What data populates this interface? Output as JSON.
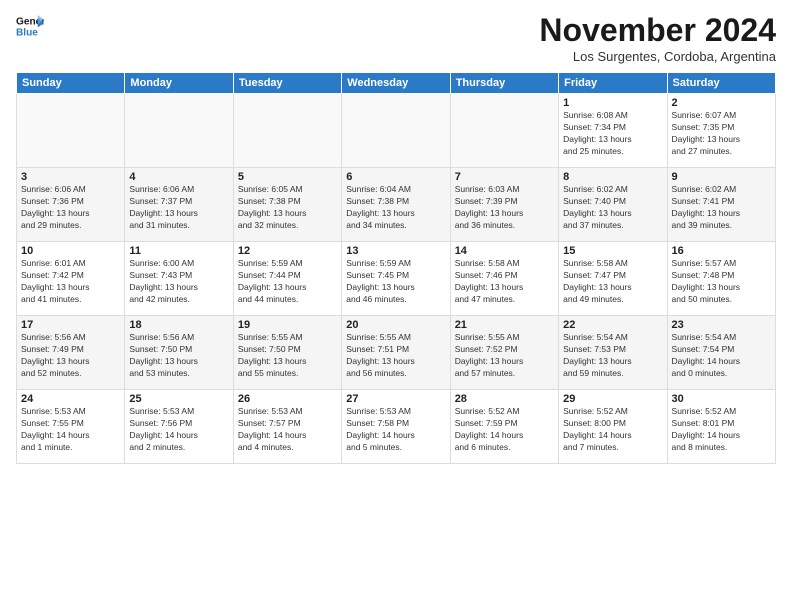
{
  "header": {
    "logo_line1": "General",
    "logo_line2": "Blue",
    "month_title": "November 2024",
    "location": "Los Surgentes, Cordoba, Argentina"
  },
  "weekdays": [
    "Sunday",
    "Monday",
    "Tuesday",
    "Wednesday",
    "Thursday",
    "Friday",
    "Saturday"
  ],
  "weeks": [
    [
      {
        "day": "",
        "info": ""
      },
      {
        "day": "",
        "info": ""
      },
      {
        "day": "",
        "info": ""
      },
      {
        "day": "",
        "info": ""
      },
      {
        "day": "",
        "info": ""
      },
      {
        "day": "1",
        "info": "Sunrise: 6:08 AM\nSunset: 7:34 PM\nDaylight: 13 hours\nand 25 minutes."
      },
      {
        "day": "2",
        "info": "Sunrise: 6:07 AM\nSunset: 7:35 PM\nDaylight: 13 hours\nand 27 minutes."
      }
    ],
    [
      {
        "day": "3",
        "info": "Sunrise: 6:06 AM\nSunset: 7:36 PM\nDaylight: 13 hours\nand 29 minutes."
      },
      {
        "day": "4",
        "info": "Sunrise: 6:06 AM\nSunset: 7:37 PM\nDaylight: 13 hours\nand 31 minutes."
      },
      {
        "day": "5",
        "info": "Sunrise: 6:05 AM\nSunset: 7:38 PM\nDaylight: 13 hours\nand 32 minutes."
      },
      {
        "day": "6",
        "info": "Sunrise: 6:04 AM\nSunset: 7:38 PM\nDaylight: 13 hours\nand 34 minutes."
      },
      {
        "day": "7",
        "info": "Sunrise: 6:03 AM\nSunset: 7:39 PM\nDaylight: 13 hours\nand 36 minutes."
      },
      {
        "day": "8",
        "info": "Sunrise: 6:02 AM\nSunset: 7:40 PM\nDaylight: 13 hours\nand 37 minutes."
      },
      {
        "day": "9",
        "info": "Sunrise: 6:02 AM\nSunset: 7:41 PM\nDaylight: 13 hours\nand 39 minutes."
      }
    ],
    [
      {
        "day": "10",
        "info": "Sunrise: 6:01 AM\nSunset: 7:42 PM\nDaylight: 13 hours\nand 41 minutes."
      },
      {
        "day": "11",
        "info": "Sunrise: 6:00 AM\nSunset: 7:43 PM\nDaylight: 13 hours\nand 42 minutes."
      },
      {
        "day": "12",
        "info": "Sunrise: 5:59 AM\nSunset: 7:44 PM\nDaylight: 13 hours\nand 44 minutes."
      },
      {
        "day": "13",
        "info": "Sunrise: 5:59 AM\nSunset: 7:45 PM\nDaylight: 13 hours\nand 46 minutes."
      },
      {
        "day": "14",
        "info": "Sunrise: 5:58 AM\nSunset: 7:46 PM\nDaylight: 13 hours\nand 47 minutes."
      },
      {
        "day": "15",
        "info": "Sunrise: 5:58 AM\nSunset: 7:47 PM\nDaylight: 13 hours\nand 49 minutes."
      },
      {
        "day": "16",
        "info": "Sunrise: 5:57 AM\nSunset: 7:48 PM\nDaylight: 13 hours\nand 50 minutes."
      }
    ],
    [
      {
        "day": "17",
        "info": "Sunrise: 5:56 AM\nSunset: 7:49 PM\nDaylight: 13 hours\nand 52 minutes."
      },
      {
        "day": "18",
        "info": "Sunrise: 5:56 AM\nSunset: 7:50 PM\nDaylight: 13 hours\nand 53 minutes."
      },
      {
        "day": "19",
        "info": "Sunrise: 5:55 AM\nSunset: 7:50 PM\nDaylight: 13 hours\nand 55 minutes."
      },
      {
        "day": "20",
        "info": "Sunrise: 5:55 AM\nSunset: 7:51 PM\nDaylight: 13 hours\nand 56 minutes."
      },
      {
        "day": "21",
        "info": "Sunrise: 5:55 AM\nSunset: 7:52 PM\nDaylight: 13 hours\nand 57 minutes."
      },
      {
        "day": "22",
        "info": "Sunrise: 5:54 AM\nSunset: 7:53 PM\nDaylight: 13 hours\nand 59 minutes."
      },
      {
        "day": "23",
        "info": "Sunrise: 5:54 AM\nSunset: 7:54 PM\nDaylight: 14 hours\nand 0 minutes."
      }
    ],
    [
      {
        "day": "24",
        "info": "Sunrise: 5:53 AM\nSunset: 7:55 PM\nDaylight: 14 hours\nand 1 minute."
      },
      {
        "day": "25",
        "info": "Sunrise: 5:53 AM\nSunset: 7:56 PM\nDaylight: 14 hours\nand 2 minutes."
      },
      {
        "day": "26",
        "info": "Sunrise: 5:53 AM\nSunset: 7:57 PM\nDaylight: 14 hours\nand 4 minutes."
      },
      {
        "day": "27",
        "info": "Sunrise: 5:53 AM\nSunset: 7:58 PM\nDaylight: 14 hours\nand 5 minutes."
      },
      {
        "day": "28",
        "info": "Sunrise: 5:52 AM\nSunset: 7:59 PM\nDaylight: 14 hours\nand 6 minutes."
      },
      {
        "day": "29",
        "info": "Sunrise: 5:52 AM\nSunset: 8:00 PM\nDaylight: 14 hours\nand 7 minutes."
      },
      {
        "day": "30",
        "info": "Sunrise: 5:52 AM\nSunset: 8:01 PM\nDaylight: 14 hours\nand 8 minutes."
      }
    ]
  ]
}
